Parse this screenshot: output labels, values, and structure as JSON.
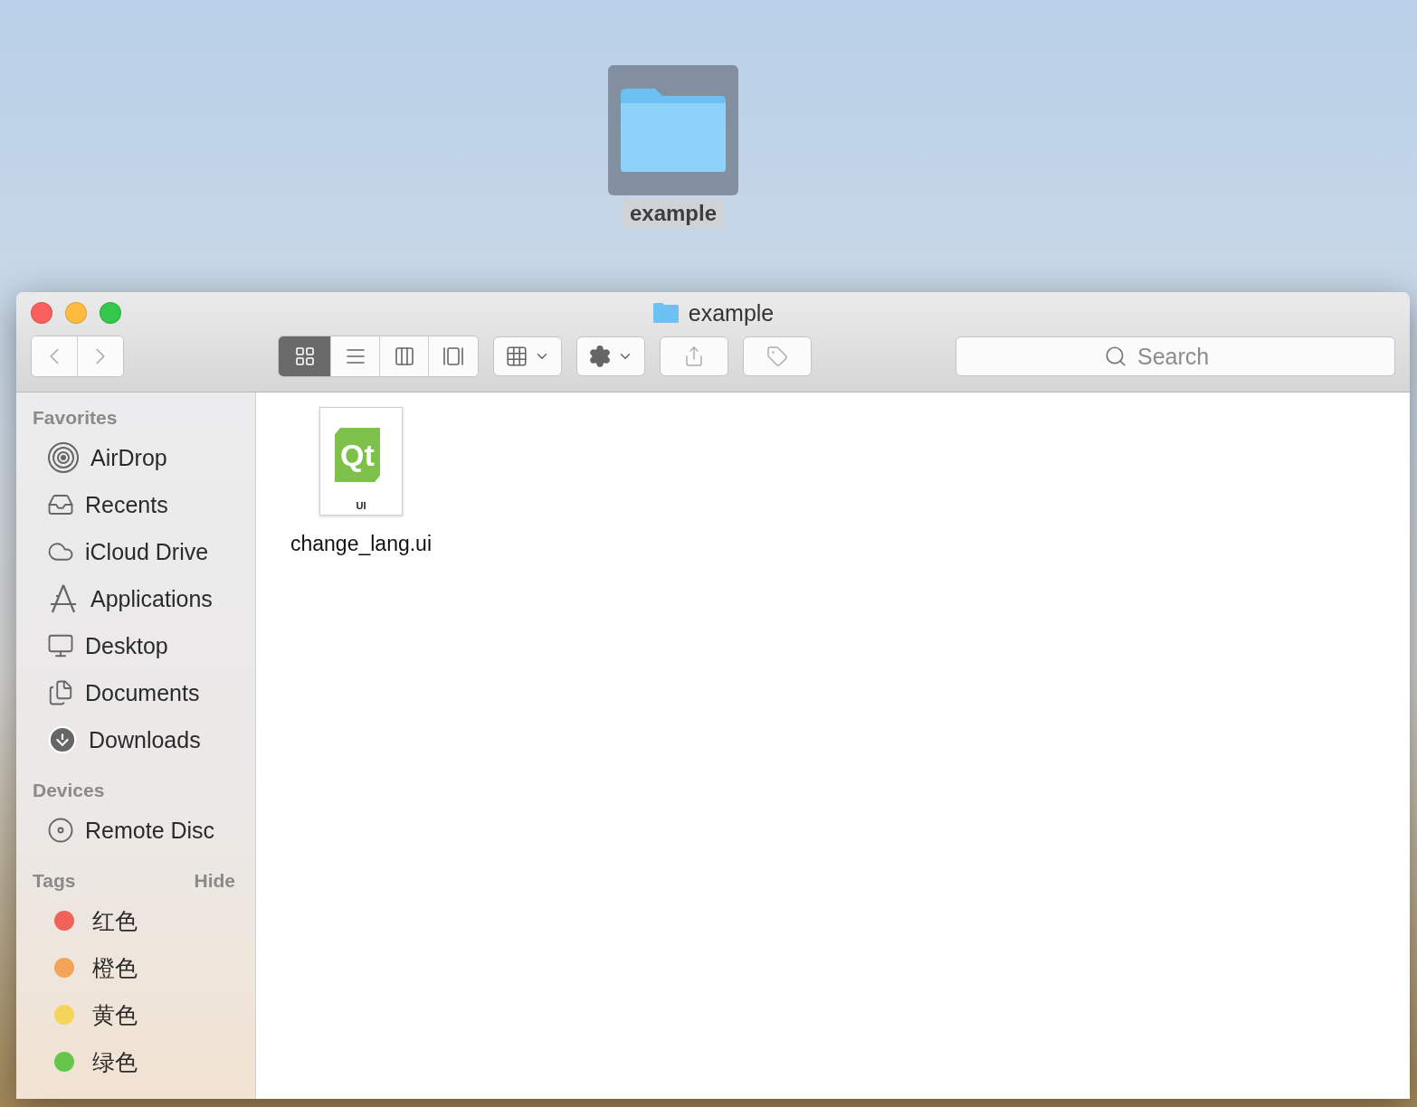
{
  "desktop": {
    "icons": [
      {
        "label": "example",
        "selected": true
      }
    ]
  },
  "window": {
    "title": "example"
  },
  "toolbar": {
    "view_modes": [
      {
        "kind": "icons",
        "selected": true
      },
      {
        "kind": "list",
        "selected": false
      },
      {
        "kind": "columns",
        "selected": false
      },
      {
        "kind": "gallery",
        "selected": false
      }
    ],
    "search": {
      "placeholder": "Search"
    }
  },
  "sidebar": {
    "sections": [
      {
        "title": "Favorites",
        "items": [
          {
            "label": "AirDrop",
            "kind": "airdrop"
          },
          {
            "label": "Recents",
            "kind": "recents"
          },
          {
            "label": "iCloud Drive",
            "kind": "cloud"
          },
          {
            "label": "Applications",
            "kind": "apps"
          },
          {
            "label": "Desktop",
            "kind": "desktop"
          },
          {
            "label": "Documents",
            "kind": "documents"
          },
          {
            "label": "Downloads",
            "kind": "downloads"
          }
        ]
      },
      {
        "title": "Devices",
        "items": [
          {
            "label": "Remote Disc",
            "kind": "disc"
          }
        ]
      }
    ],
    "tags": {
      "title": "Tags",
      "action": "Hide",
      "items": [
        {
          "label": "红色",
          "color": "#f0625a"
        },
        {
          "label": "橙色",
          "color": "#f4a456"
        },
        {
          "label": "黄色",
          "color": "#f5d45a"
        },
        {
          "label": "绿色",
          "color": "#66c64a"
        }
      ]
    }
  },
  "files": [
    {
      "name": "change_lang.ui",
      "logo": "Qt",
      "badge": "UI"
    }
  ]
}
